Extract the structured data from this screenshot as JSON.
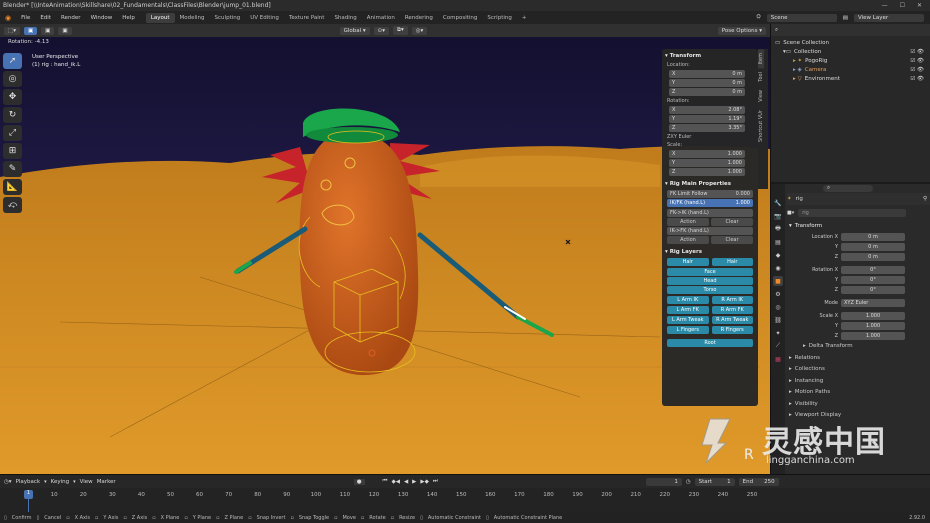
{
  "titlebar": {
    "title": "Blender* [\\\\InteAnimation\\Skillshare\\02_Fundamentals\\ClassFiles\\Blender\\jump_01.blend]"
  },
  "menu": {
    "items": [
      "File",
      "Edit",
      "Render",
      "Window",
      "Help"
    ],
    "workspaces": [
      "Layout",
      "Modeling",
      "Sculpting",
      "UV Editing",
      "Texture Paint",
      "Shading",
      "Animation",
      "Rendering",
      "Compositing",
      "Scripting"
    ],
    "add_tab": "+",
    "scene_label": "Scene",
    "view_layer_label": "View Layer"
  },
  "header": {
    "orientation": "Global",
    "pose_options": "Pose Options"
  },
  "viewport": {
    "rotation_readout": "Rotation: -4.13",
    "view_name": "User Perspective",
    "object_name": "(1) rig : hand_ik.L"
  },
  "npanel": {
    "tabs": [
      "Item",
      "Tool",
      "View",
      "Shortcut VUr"
    ],
    "transform_title": "Transform",
    "location_label": "Location:",
    "location": [
      {
        "axis": "X",
        "value": "0 m"
      },
      {
        "axis": "Y",
        "value": "0 m"
      },
      {
        "axis": "Z",
        "value": "0 m"
      }
    ],
    "rotation_label": "Rotation:",
    "rotation": [
      {
        "axis": "X",
        "value": "2.08°"
      },
      {
        "axis": "Y",
        "value": "1.19°"
      },
      {
        "axis": "Z",
        "value": "3.35°"
      }
    ],
    "rotation_mode": "ZXY Euler",
    "scale_label": "Scale:",
    "scale": [
      {
        "axis": "X",
        "value": "1.000"
      },
      {
        "axis": "Y",
        "value": "1.000"
      },
      {
        "axis": "Z",
        "value": "1.000"
      }
    ],
    "rig_main_title": "Rig Main Properties",
    "fk_limit_label": "FK Limit Follow",
    "fk_limit_value": "0.000",
    "ikfk_label": "IK/FK (hand.L)",
    "ikfk_value": "1.000",
    "fk_to_ik": "FK->IK (hand.L)",
    "ik_to_fk": "IK->FK (hand.L)",
    "action": "Action",
    "clear": "Clear",
    "rig_layers_title": "Rig Layers",
    "layers": [
      [
        "Hair",
        "Hair"
      ],
      [
        "Face"
      ],
      [
        "Head"
      ],
      [
        "Torso"
      ],
      [
        "L Arm IK",
        "R Arm IK"
      ],
      [
        "L Arm FK",
        "R Arm FK"
      ],
      [
        "L Arm Tweak",
        "R Arm Tweak"
      ],
      [
        "L Fingers",
        "R Fingers"
      ]
    ],
    "root": "Root"
  },
  "outliner": {
    "rows": [
      {
        "label": "Scene Collection",
        "indent": 0
      },
      {
        "label": "Collection",
        "indent": 1
      },
      {
        "label": "PogoRig",
        "indent": 2
      },
      {
        "label": "Camera",
        "indent": 2
      },
      {
        "label": "Environment",
        "indent": 2
      }
    ]
  },
  "properties": {
    "object_name": "rig",
    "data_name": "rig",
    "transform_title": "Transform",
    "location_label": "Location X",
    "location": [
      "0 m",
      "0 m",
      "0 m"
    ],
    "rotation_label": "Rotation X",
    "rotation": [
      "0°",
      "0°",
      "0°"
    ],
    "mode_label": "Mode",
    "mode_value": "XYZ Euler",
    "scale_label": "Scale X",
    "scale": [
      "1.000",
      "1.000",
      "1.000"
    ],
    "y_label": "Y",
    "z_label": "Z",
    "delta_transform": "Delta Transform",
    "panels": [
      "Relations",
      "Collections",
      "Instancing",
      "Motion Paths",
      "Visibility",
      "Viewport Display"
    ]
  },
  "timeline": {
    "menus": [
      "Playback",
      "Keying",
      "View",
      "Marker"
    ],
    "current_frame": "1",
    "start_label": "Start",
    "start_value": "1",
    "end_label": "End",
    "end_value": "250",
    "ticks": [
      "1",
      "10",
      "20",
      "30",
      "40",
      "50",
      "60",
      "70",
      "80",
      "90",
      "100",
      "110",
      "120",
      "130",
      "140",
      "150",
      "160",
      "170",
      "180",
      "190",
      "200",
      "210",
      "220",
      "230",
      "240",
      "250"
    ]
  },
  "status": {
    "items": [
      "Confirm",
      "Cancel",
      "X Axis",
      "Y Axis",
      "Z Axis",
      "X Plane",
      "Y Plane",
      "Z Plane",
      "Snap Invert",
      "Snap Toggle",
      "Move",
      "Rotate",
      "Resize",
      "Automatic Constraint",
      "Automatic Constraint Plane"
    ],
    "version": "2.92.0"
  },
  "watermark": {
    "brand": "灵感中国",
    "url": "lingganchina.com",
    "letter": "R"
  },
  "colors": {
    "accent": "#4772b3",
    "layer": "#2a8aa8",
    "ground": "#d0881d",
    "sky": "#1e1a3c",
    "potato": "#cd5a17"
  }
}
